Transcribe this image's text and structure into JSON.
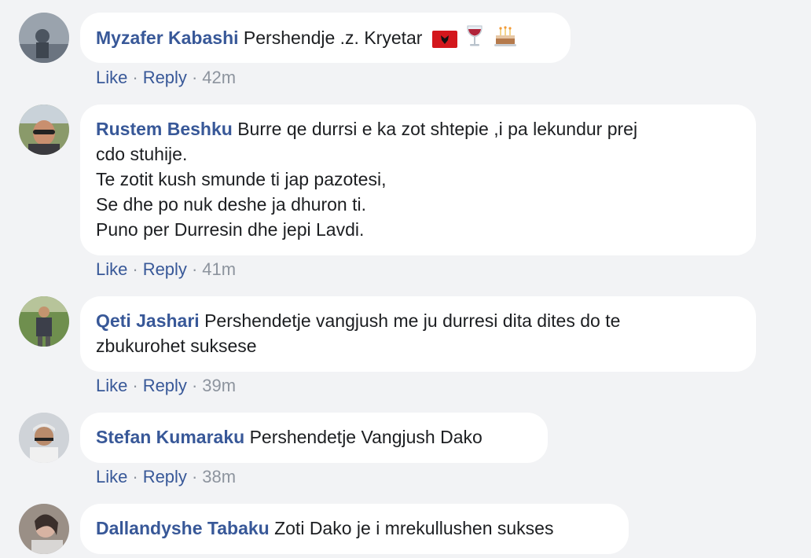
{
  "actions": {
    "like": "Like",
    "reply": "Reply",
    "separator": "·"
  },
  "comments": [
    {
      "author": "Myzafer Kabashi",
      "text": "Pershendje .z. Kryetar",
      "time": "42m"
    },
    {
      "author": "Rustem Beshku",
      "text": "Burre qe durrsi e ka zot shtepie ,i pa lekundur prej\ncdo stuhije.\nTe zotit kush smunde ti jap pazotesi,\nSe dhe po nuk deshe ja dhuron ti.\nPuno per Durresin dhe jepi Lavdi.",
      "time": "41m"
    },
    {
      "author": "Qeti Jashari",
      "text": "Pershendetje vangjush me ju durresi dita dites do te\nzbukurohet suksese",
      "time": "39m"
    },
    {
      "author": "Stefan Kumaraku",
      "text": "Pershendetje Vangjush Dako",
      "time": "38m"
    },
    {
      "author": "Dallandyshe Tabaku",
      "text": "Zoti Dako je i mrekullushen sukses",
      "time": ""
    }
  ],
  "emojis": [
    "albania-flag-icon",
    "wine-glass-icon",
    "birthday-cake-icon"
  ]
}
